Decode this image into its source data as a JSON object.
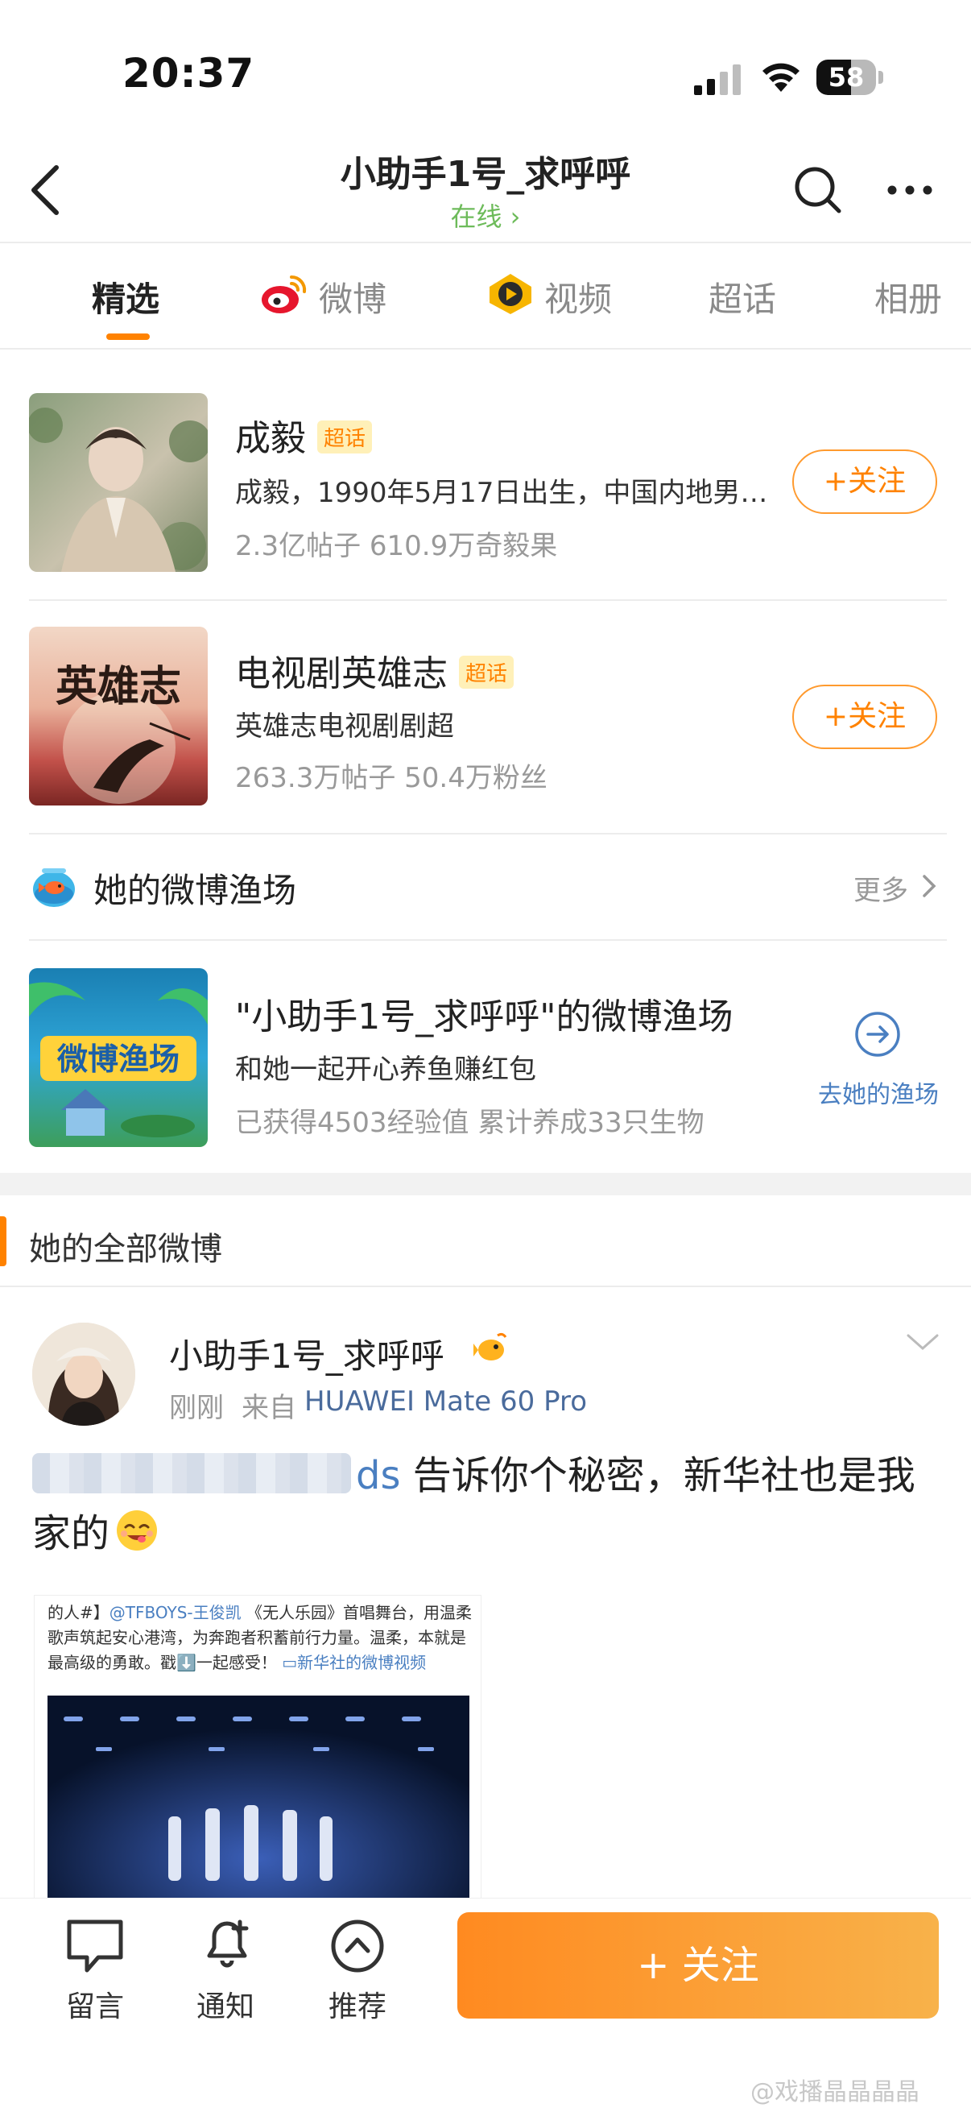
{
  "status_bar": {
    "time": "20:37",
    "battery_level": "58",
    "battery_fraction": 0.58
  },
  "nav": {
    "title": "小助手1号_求呼呼",
    "subtitle": "在线 ›"
  },
  "tabs": [
    {
      "label": "精选",
      "active": true
    },
    {
      "label": "微博",
      "icon": "weibo-logo-icon"
    },
    {
      "label": "视频",
      "icon": "video-play-icon"
    },
    {
      "label": "超话"
    },
    {
      "label": "相册"
    }
  ],
  "super_topics": [
    {
      "title": "成毅",
      "badge": "超话",
      "desc": "成毅，1990年5月17日出生，中国内地男演员",
      "meta": "2.3亿帖子 610.9万奇毅果",
      "follow": "+关注"
    },
    {
      "title": "电视剧英雄志",
      "badge": "超话",
      "desc": "英雄志电视剧剧超",
      "meta": "263.3万帖子 50.4万粉丝",
      "follow": "+关注",
      "poster_text": "英雄志"
    }
  ],
  "fishing": {
    "section_title": "她的微博渔场",
    "more": "更多",
    "card_title": "\"小助手1号_求呼呼\"的微博渔场",
    "card_desc": "和她一起开心养鱼赚红包",
    "card_meta": "已获得4503经验值 累计养成33只生物",
    "go_label": "去她的渔场",
    "logo_text": "微博渔场"
  },
  "feed": {
    "section_title": "她的全部微博",
    "post": {
      "author": "小助手1号_求呼呼",
      "time": "刚刚",
      "source_prefix": "来自",
      "device": "HUAWEI Mate 60 Pro",
      "mention_tail": "ds",
      "text": " 告诉你个秘密，新华社也是我家的",
      "embed_prefix": "的人#】",
      "embed_link1": "@TFBOYS-王俊凯",
      "embed_body": " 《无人乐园》首唱舞台，用温柔歌声筑起安心港湾，为奔跑者积蓄前行力量。温柔，本就是最高级的勇敢。戳⬇️一起感受！",
      "embed_link2": "新华社的微博视频"
    }
  },
  "bottom_bar": {
    "message": "留言",
    "notify": "通知",
    "recommend": "推荐",
    "follow": "+ 关注"
  },
  "watermark": "@戏播晶晶晶晶",
  "colors": {
    "accent": "#ff8200",
    "link": "#4a7fc1",
    "online": "#6dbb5a"
  }
}
